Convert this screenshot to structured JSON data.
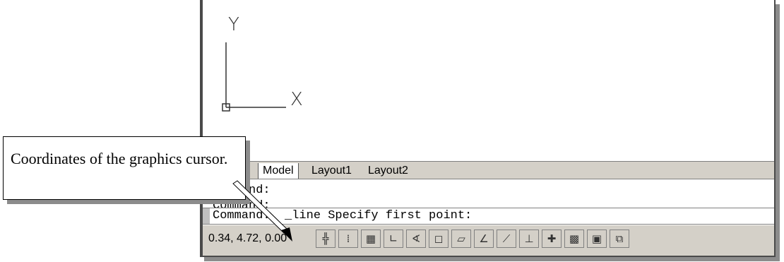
{
  "viewport": {
    "axis_y_label": "Y",
    "axis_x_label": "X"
  },
  "tabs": {
    "items": [
      "Model",
      "Layout1",
      "Layout2"
    ],
    "active": "Model"
  },
  "command_history": [
    "Command:",
    "Command:"
  ],
  "command_prompt": "Command:  _line Specify first point:",
  "status_bar": {
    "coordinates": "0.34, 4.72, 0.00",
    "toggles": [
      "infer-constraints",
      "snap",
      "grid",
      "ortho",
      "polar",
      "object-snap",
      "3d-object-snap",
      "object-snap-tracking",
      "dynamic-ucs",
      "dynamic-input",
      "lineweight",
      "transparency",
      "quick-properties",
      "selection-cycling"
    ]
  },
  "callout": {
    "text": "Coordinates of the graphics cursor."
  },
  "colors": {
    "frame": "#4a4a4a",
    "shadow": "#8c8c8c",
    "status_bg": "#d4d0c8"
  }
}
